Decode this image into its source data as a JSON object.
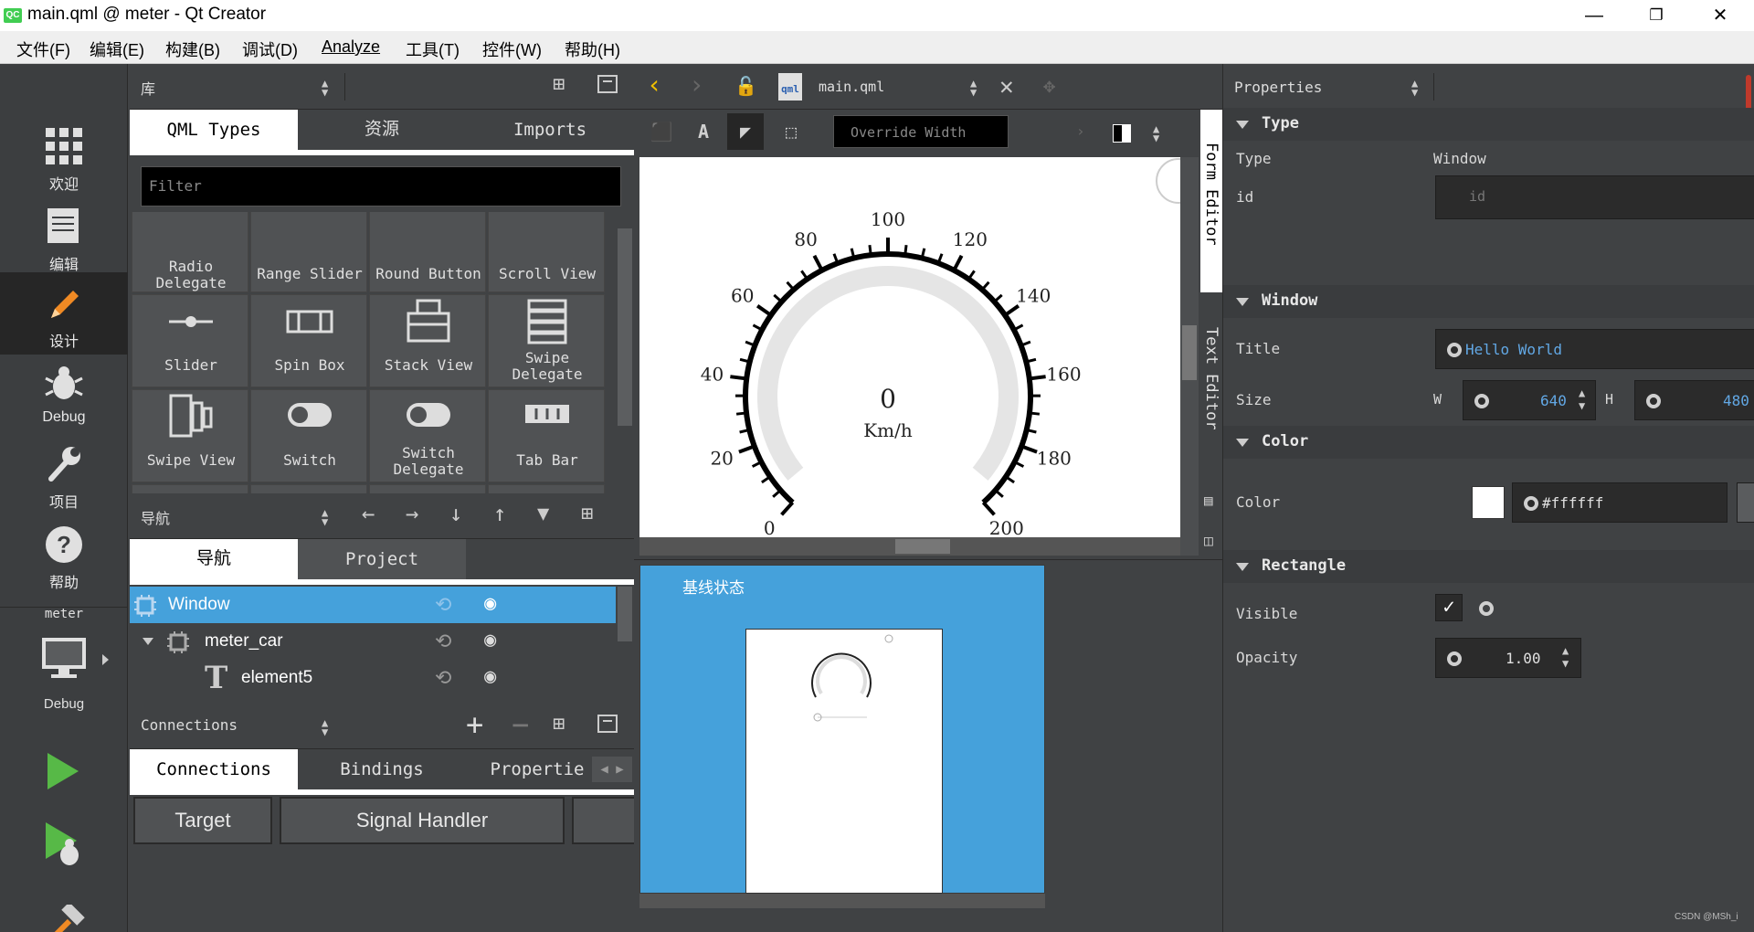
{
  "window": {
    "title": "main.qml @ meter - Qt Creator",
    "logo": "QC"
  },
  "menu": [
    {
      "label": "文件(F)"
    },
    {
      "label": "编辑(E)"
    },
    {
      "label": "构建(B)"
    },
    {
      "label": "调试(D)"
    },
    {
      "label": "Analyze"
    },
    {
      "label": "工具(T)"
    },
    {
      "label": "控件(W)"
    },
    {
      "label": "帮助(H)"
    }
  ],
  "modes": [
    {
      "label": "欢迎",
      "icon": "grid-icon"
    },
    {
      "label": "编辑",
      "icon": "document-icon"
    },
    {
      "label": "设计",
      "icon": "pencil-icon"
    },
    {
      "label": "Debug",
      "icon": "bug-icon"
    },
    {
      "label": "项目",
      "icon": "wrench-icon"
    },
    {
      "label": "帮助",
      "icon": "help-icon"
    }
  ],
  "kit": {
    "project": "meter",
    "label": "Debug"
  },
  "library": {
    "title": "库",
    "tabs": [
      "QML Types",
      "资源",
      "Imports"
    ],
    "filter_placeholder": "Filter",
    "items": [
      "Radio Delegate",
      "Range Slider",
      "Round Button",
      "Scroll View",
      "Slider",
      "Spin Box",
      "Stack View",
      "Swipe Delegate",
      "Swipe View",
      "Switch",
      "Switch Delegate",
      "Tab Bar"
    ]
  },
  "navigator": {
    "title": "导航",
    "tabs": [
      "导航",
      "Project"
    ],
    "rows": [
      {
        "name": "Window"
      },
      {
        "name": "meter_car"
      },
      {
        "name": "element5"
      }
    ]
  },
  "connections": {
    "title": "Connections",
    "tabs": [
      "Connections",
      "Bindings",
      "Propertie"
    ],
    "columns": [
      "Target",
      "Signal Handler"
    ]
  },
  "editor": {
    "file": "main.qml",
    "override_placeholder": "Override Width",
    "side_tabs": [
      "Form Editor",
      "Text Editor"
    ],
    "gauge": {
      "value": "0",
      "unit": "Km/h",
      "ticks": [
        "0",
        "20",
        "40",
        "60",
        "80",
        "100",
        "120",
        "140",
        "160",
        "180",
        "200"
      ]
    },
    "state_label": "基线状态"
  },
  "properties": {
    "title": "Properties",
    "sections": {
      "type": "Type",
      "window": "Window",
      "color": "Color",
      "rectangle": "Rectangle"
    },
    "labels": {
      "type": "Type",
      "id": "id",
      "title": "Title",
      "size": "Size",
      "w": "W",
      "h": "H",
      "color": "Color",
      "visible": "Visible",
      "opacity": "Opacity"
    },
    "type_value": "Window",
    "id_placeholder": "id",
    "title_value": "Hello World",
    "width": "640",
    "height": "480",
    "color_value": "#ffffff",
    "opacity": "1.00"
  },
  "watermark": "CSDN @MSh_i"
}
